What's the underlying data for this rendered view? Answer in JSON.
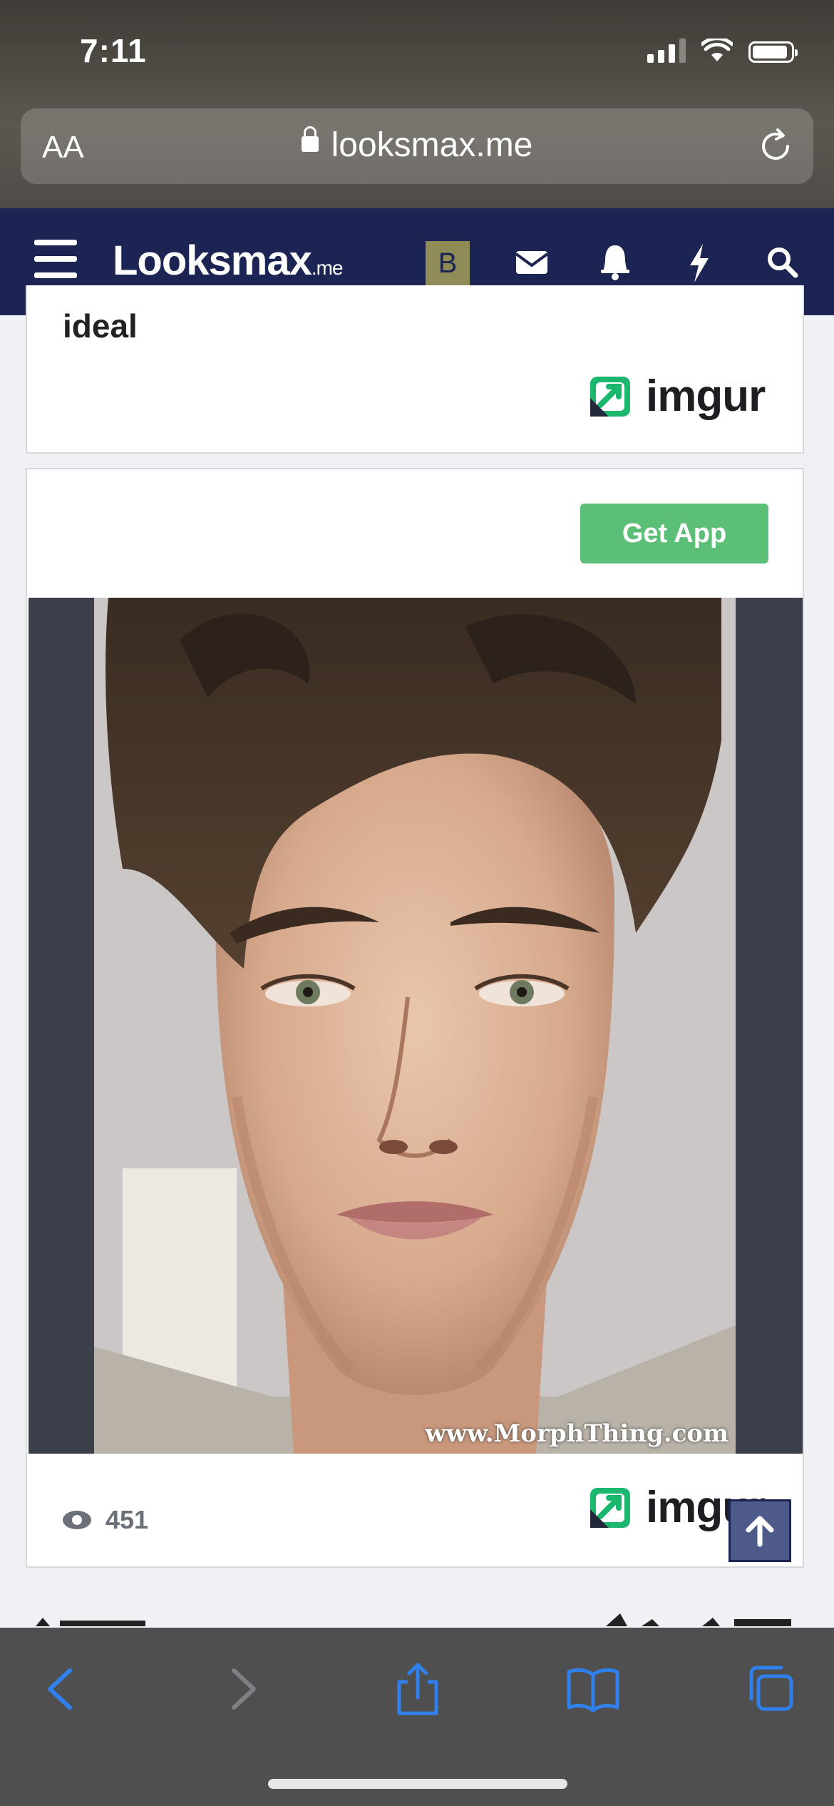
{
  "status_bar": {
    "time": "7:11"
  },
  "browser": {
    "text_size_label": "AA",
    "url": "looksmax.me"
  },
  "site_nav": {
    "logo_text": "Looksmax",
    "logo_suffix": ".me",
    "avatar_letter": "B"
  },
  "post_top": {
    "title_fragment": "ideal",
    "imgur_label": "imgur"
  },
  "post_image_card": {
    "get_app_label": "Get App",
    "image_watermark": "www.MorphThing.com",
    "view_count": "451",
    "imgur_label": "imgur"
  },
  "colors": {
    "nav_bg": "#1b2452",
    "get_app_green": "#5cbf78",
    "imgur_green": "#1bb76e",
    "safari_toolbar": "#4f4f50",
    "safari_accent": "#2f80ed"
  },
  "icons": {
    "nav": [
      "menu-icon",
      "envelope-icon",
      "bell-icon",
      "bolt-icon",
      "search-icon"
    ],
    "toolbar": [
      "back-icon",
      "forward-icon",
      "share-icon",
      "bookmarks-icon",
      "tabs-icon"
    ]
  }
}
